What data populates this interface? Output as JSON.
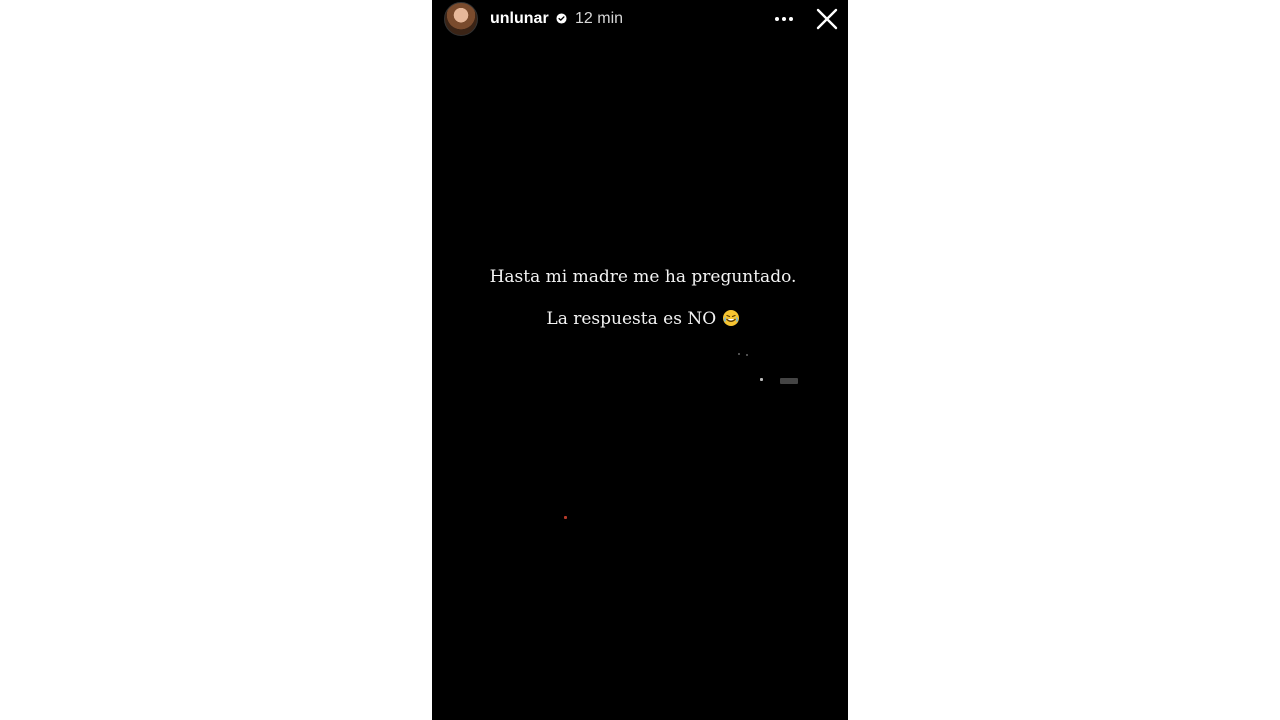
{
  "story": {
    "username": "unlunar",
    "time_ago": "12 min",
    "caption_line1": "Hasta mi madre me ha preguntado.",
    "caption_line2": "La respuesta es NO",
    "emoji": "rolling-on-the-floor-laughing-icon"
  },
  "icons": {
    "verified": "verified-badge-icon",
    "more": "more-options-icon",
    "close": "close-icon"
  },
  "colors": {
    "story_background": "#000000",
    "page_background": "#ffffff",
    "text": "#ffffff",
    "verified_badge": "#ffffff"
  }
}
